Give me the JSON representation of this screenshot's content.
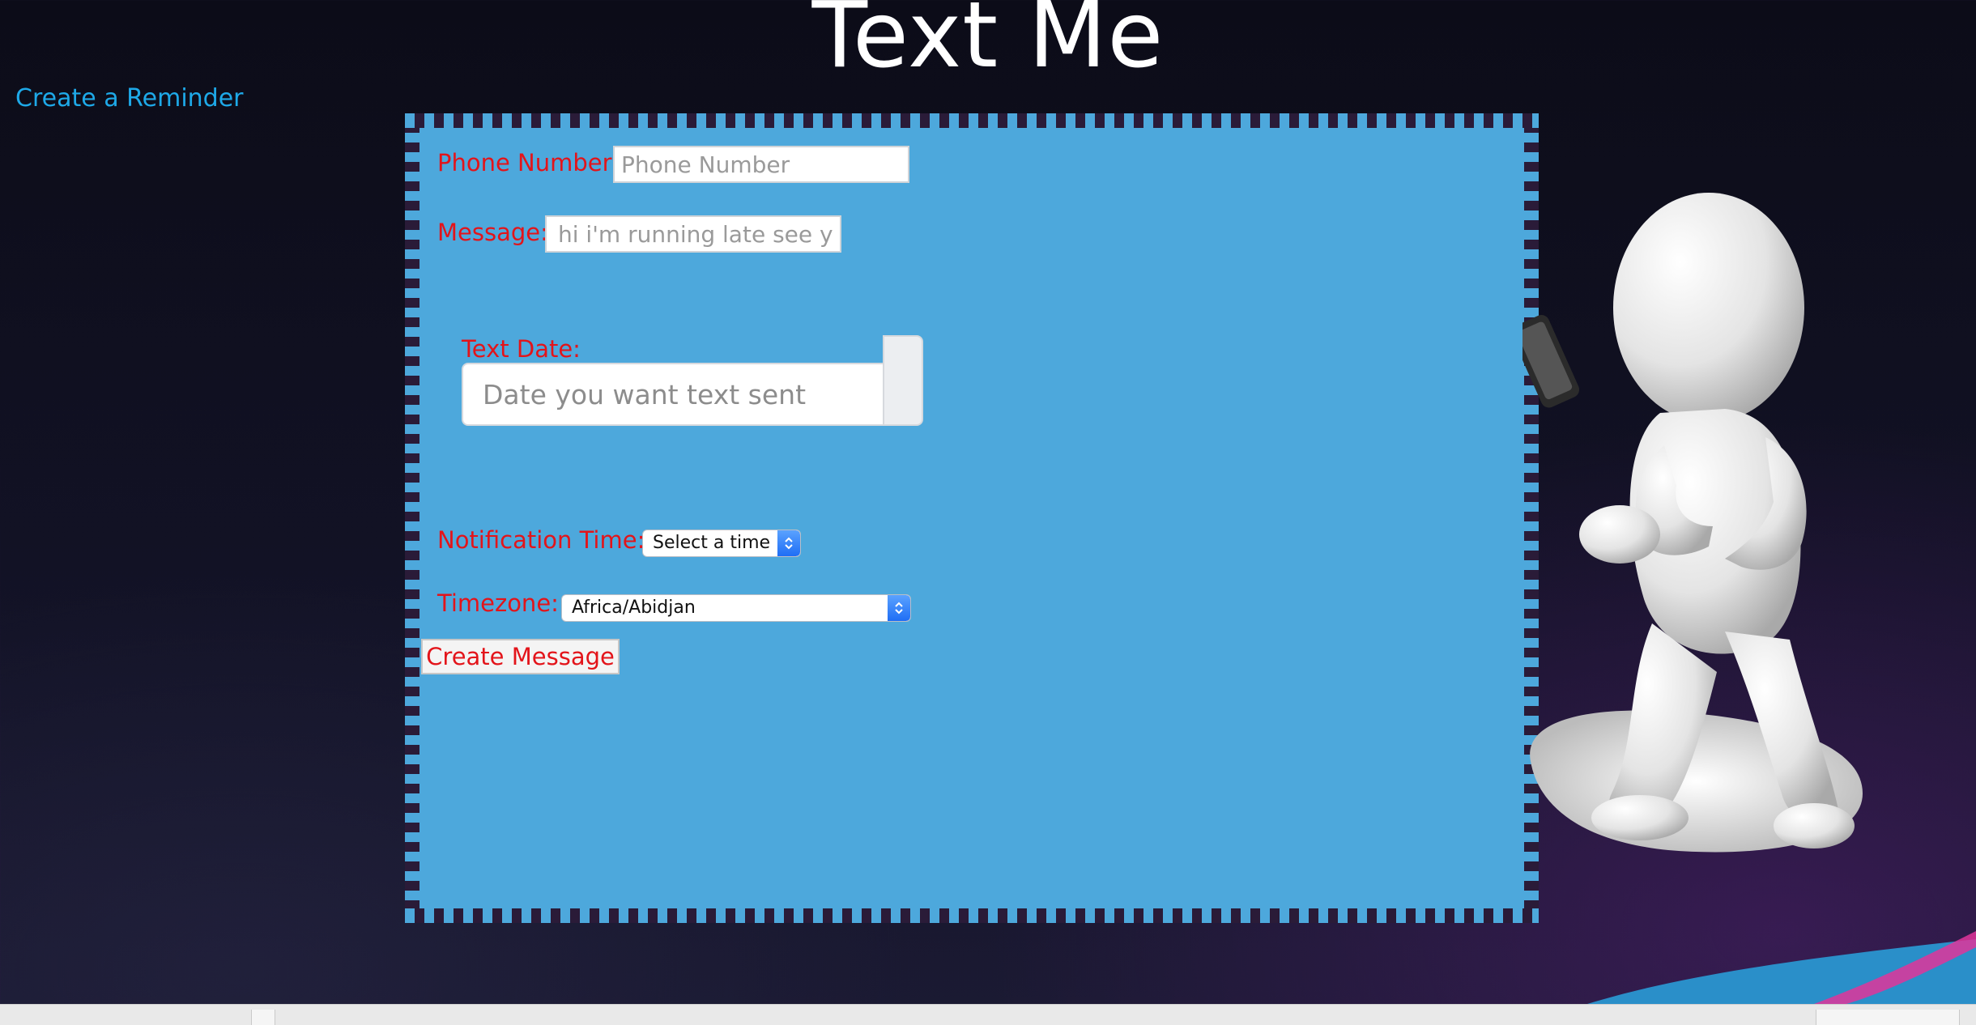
{
  "header": {
    "title": "Text Me"
  },
  "nav": {
    "create_reminder": "Create a Reminder"
  },
  "form": {
    "phone": {
      "label": "Phone Number:",
      "placeholder": "Phone Number"
    },
    "message": {
      "label": "Message:",
      "placeholder": "hi i'm running late see you soon"
    },
    "date": {
      "label": "Text Date:",
      "placeholder": "Date you want text sent"
    },
    "notification_time": {
      "label": "Notification Time:",
      "selected": "Select a time"
    },
    "timezone": {
      "label": "Timezone:",
      "selected": "Africa/Abidjan"
    },
    "submit_label": "Create Message"
  },
  "colors": {
    "background": "#0f0f1c",
    "panel": "#4da8dc",
    "panel_border": "#2a1b38",
    "label": "#e3141a",
    "link": "#1ea9e8",
    "select_arrow": "#2f7bf7"
  },
  "icons": {
    "figure": "person-with-phone-illustration",
    "select_arrow": "chevron-updown-icon",
    "date_addon": "calendar-addon"
  }
}
